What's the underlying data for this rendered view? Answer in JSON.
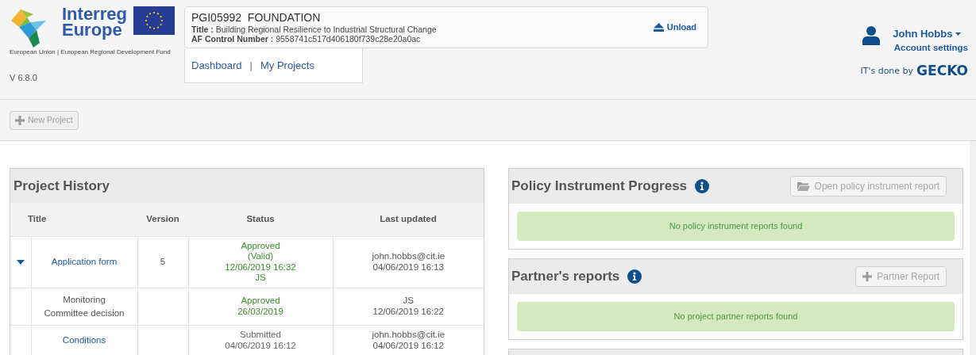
{
  "header": {
    "logo": {
      "name_line1": "Interreg",
      "name_line2": "Europe",
      "tagline": "European Union | European Regional Development Fund"
    },
    "version": "V 6.8.0",
    "project": {
      "code": "PGI05992",
      "acronym": "FOUNDATION",
      "title_label": "Title :",
      "title": "Building Regional Resilience to Industrial Structural Change",
      "control_label": "AF Control Number :",
      "control": "9558741c517d406180f739c28e20a0ac",
      "unload": "Unload"
    },
    "nav": [
      {
        "label": "Dashboard"
      },
      {
        "label": "My Projects"
      }
    ],
    "nav_separator": "|",
    "user": {
      "name": "John Hobbs",
      "account": "Account settings"
    },
    "credit": {
      "prefix": "IT's done by",
      "brand": "GECKO"
    }
  },
  "toolbar": {
    "new_project": {
      "label": "New Project",
      "disabled": true
    }
  },
  "history": {
    "title": "Project History",
    "columns": [
      "Title",
      "Version",
      "Status",
      "Last updated"
    ],
    "rows": [
      {
        "caret": true,
        "link": true,
        "title": "Application form",
        "version": "5",
        "status": [
          "Approved",
          "(Valid)",
          "12/06/2019 16:32",
          "JS"
        ],
        "color": "#3c8c2c",
        "updated": [
          "john.hobbs@cit.ie",
          "04/06/2019 16:13"
        ]
      },
      {
        "caret": false,
        "link": false,
        "title": "Monitoring Committee decision",
        "status": [
          "Approved",
          "26/03/2019"
        ],
        "color": "#3c8c2c",
        "updated": [
          "JS",
          "12/06/2019 16:22"
        ]
      },
      {
        "caret": false,
        "link": true,
        "title": "Conditions",
        "status": [
          "Submitted",
          "04/06/2019 16:12"
        ],
        "color": "#666666",
        "updated": [
          "john.hobbs@cit.ie",
          "04/06/2019 16:12"
        ]
      }
    ]
  },
  "panels": [
    {
      "title": "Policy Instrument Progress",
      "button": {
        "kind": "folder",
        "label": "Open policy instrument report",
        "disabled": true
      },
      "message": "No policy instrument reports found"
    },
    {
      "title": "Partner's reports",
      "button": {
        "kind": "plus",
        "label": "Partner Report",
        "disabled": true
      },
      "message": "No project partner reports found"
    }
  ]
}
